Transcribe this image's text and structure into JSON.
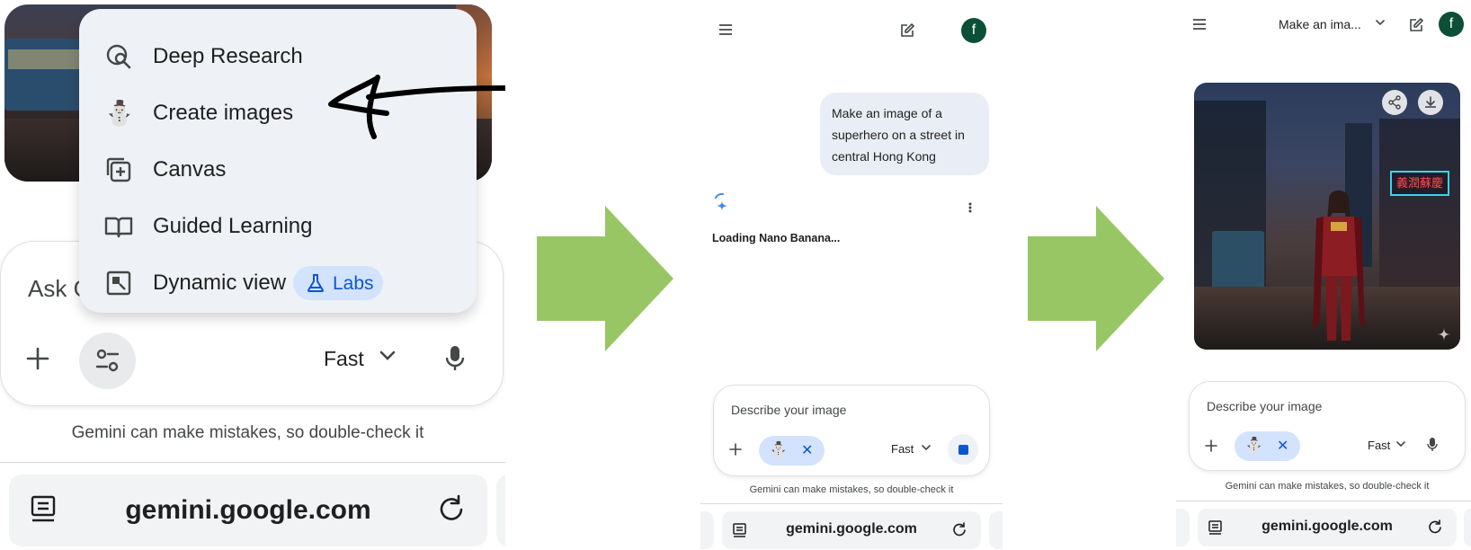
{
  "panel1": {
    "menu": {
      "items": [
        {
          "label": "Deep Research",
          "icon": "deep-research-icon"
        },
        {
          "label": "Create images",
          "icon": "snowman-emoji"
        },
        {
          "label": "Canvas",
          "icon": "canvas-icon"
        },
        {
          "label": "Guided Learning",
          "icon": "book-icon"
        },
        {
          "label": "Dynamic view",
          "icon": "dynamic-view-icon"
        }
      ],
      "labs_badge": "Labs",
      "snowman": "⛄"
    },
    "input": {
      "placeholder_partial": "Ask G",
      "mode_label": "Fast"
    },
    "disclaimer": "Gemini can make mistakes, so double-check it",
    "url": "gemini.google.com"
  },
  "panel2": {
    "avatar_letter": "f",
    "user_prompt": "Make an image of a superhero on a street in central Hong Kong",
    "loading_text": "Loading Nano Banana...",
    "input": {
      "placeholder": "Describe your image",
      "chip_emoji": "⛄",
      "chip_close": "✕",
      "mode_label": "Fast"
    },
    "disclaimer": "Gemini can make mistakes, so double-check it",
    "url": "gemini.google.com"
  },
  "panel3": {
    "title": "Make an ima...",
    "avatar_letter": "f",
    "image_sign_text": "義潤蘇慶",
    "input": {
      "placeholder": "Describe your image",
      "chip_emoji": "⛄",
      "chip_close": "✕",
      "mode_label": "Fast"
    },
    "disclaimer": "Gemini can make mistakes, so double-check it",
    "url": "gemini.google.com"
  },
  "colors": {
    "arrow_green": "#98c664",
    "accent_blue": "#0b57d0",
    "chip_blue": "#d3e3fd",
    "avatar_green": "#0c4f37",
    "menu_bg": "#eef1f6"
  }
}
